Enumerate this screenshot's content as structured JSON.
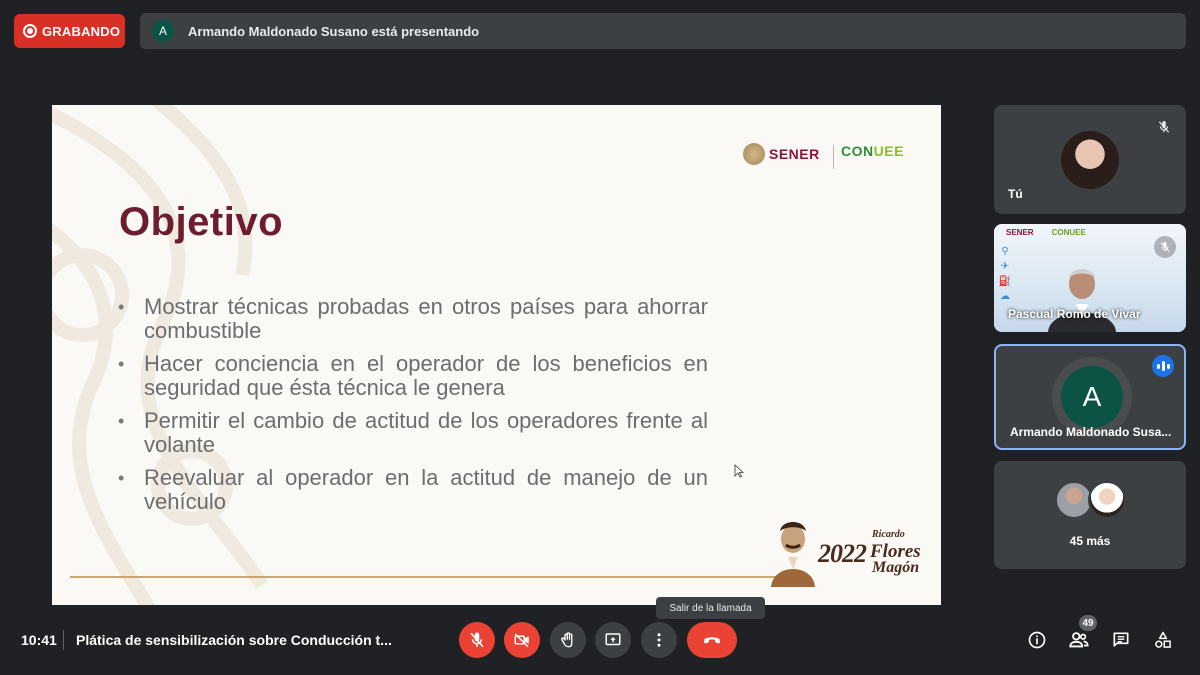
{
  "recording": {
    "label": "GRABANDO"
  },
  "presenter_bar": {
    "avatar_letter": "A",
    "text": "Armando Maldonado Susano está presentando"
  },
  "slide": {
    "title": "Objetivo",
    "bullets": [
      "Mostrar técnicas probadas en otros países para ahorrar combustible",
      "Hacer conciencia en el operador de los beneficios en seguridad que ésta técnica le genera",
      "Permitir el cambio de actitud de los operadores frente al volante",
      "Reevaluar al operador en la actitud de manejo de un vehículo"
    ],
    "logo_sener": "SENER",
    "logo_conuee_a": "CON",
    "logo_conuee_b": "UEE",
    "commemorative": {
      "year": "2022",
      "line1": "Ricardo",
      "line2": "Flores",
      "line3": "Magón"
    }
  },
  "participants": {
    "you": {
      "name": "Tú",
      "icon": "mic-off-icon"
    },
    "pascual": {
      "name": "Pascual Romo de Vivar",
      "logo_a": "SENER",
      "logo_b": "CONUEE",
      "icon": "mic-off-icon"
    },
    "armando": {
      "name": "Armando Maldonado Susa...",
      "avatar_letter": "A",
      "icon": "speaking-icon"
    },
    "more": {
      "label": "45 más"
    }
  },
  "tooltip": "Salir de la llamada",
  "footer": {
    "time": "10:41",
    "meeting_title": "Plática de sensibilización sobre Conducción t...",
    "participants_count": "49"
  },
  "colors": {
    "accent_red": "#ea4335",
    "recording_red": "#d93025",
    "active_border": "#8ab4f8",
    "slide_title": "#6e1c2f"
  }
}
